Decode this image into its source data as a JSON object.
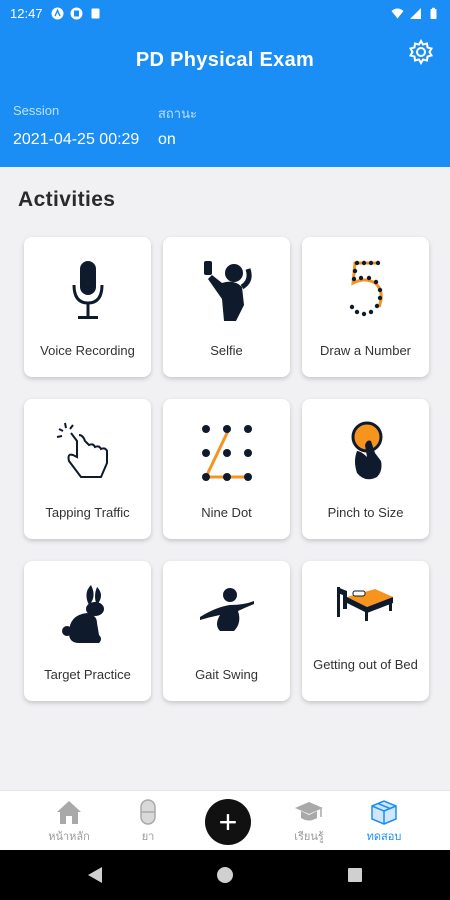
{
  "status_bar": {
    "time": "12:47"
  },
  "header": {
    "title": "PD Physical Exam",
    "session_label": "Session",
    "session_value": "2021-04-25 00:29",
    "status_label": "สถานะ",
    "status_value": "on"
  },
  "activities": {
    "title": "Activities",
    "items": [
      {
        "label": "Voice Recording",
        "icon": "microphone-icon"
      },
      {
        "label": "Selfie",
        "icon": "selfie-person-icon"
      },
      {
        "label": "Draw a Number",
        "icon": "dotted-five-icon"
      },
      {
        "label": "Tapping Traffic",
        "icon": "tapping-hand-icon"
      },
      {
        "label": "Nine Dot",
        "icon": "nine-dot-icon"
      },
      {
        "label": "Pinch to Size",
        "icon": "pinch-hand-icon"
      },
      {
        "label": "Target Practice",
        "icon": "rabbit-icon"
      },
      {
        "label": "Gait Swing",
        "icon": "gait-swing-person-icon"
      },
      {
        "label": "Getting out of Bed",
        "icon": "bed-icon"
      }
    ]
  },
  "bottom_nav": {
    "items": [
      {
        "label": "หน้าหลัก",
        "icon": "home-icon"
      },
      {
        "label": "ยา",
        "icon": "pill-icon"
      },
      {
        "label": "เรียนรู้",
        "icon": "graduation-cap-icon"
      },
      {
        "label": "ทดสอบ",
        "icon": "box-icon",
        "active": true
      }
    ],
    "add_label": "+"
  },
  "colors": {
    "primary": "#1a8ef5",
    "accent": "#f7941d",
    "dark": "#0f1b2d"
  }
}
